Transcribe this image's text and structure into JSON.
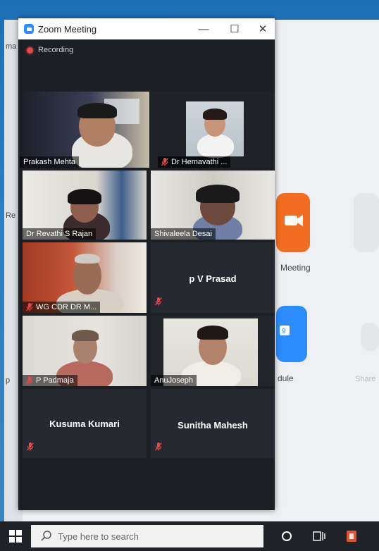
{
  "window": {
    "title": "Zoom Meeting",
    "minimize": "—",
    "maximize": "☐",
    "close": "✕",
    "recording_label": "Recording"
  },
  "participants": [
    {
      "name": "Prakash Mehta",
      "muted": false,
      "video": true,
      "active": true
    },
    {
      "name": "Dr Hemavathi ...",
      "muted": true,
      "video": true,
      "active": false
    },
    {
      "name": "Dr Revathi S Rajan",
      "muted": false,
      "video": true,
      "active": false
    },
    {
      "name": "Shivaleela Desai",
      "muted": false,
      "video": true,
      "active": false
    },
    {
      "name": "WG CDR DR M...",
      "muted": true,
      "video": true,
      "active": false
    },
    {
      "name": "p V Prasad",
      "muted": true,
      "video": false,
      "active": false
    },
    {
      "name": "P Padmaja",
      "muted": true,
      "video": true,
      "active": false
    },
    {
      "name": "AnuJoseph",
      "muted": false,
      "video": true,
      "active": false
    },
    {
      "name": "Kusuma Kumari",
      "muted": true,
      "video": false,
      "active": false
    },
    {
      "name": "Sunitha Mahesh",
      "muted": true,
      "video": false,
      "active": false
    }
  ],
  "background_app": {
    "meeting_label": "Meeting",
    "schedule_label": "dule",
    "share_label": "Share",
    "left_clipped": [
      "ma",
      "Re",
      "p"
    ],
    "brand_colors": {
      "orange": "#f26d21",
      "blue": "#2d8cff"
    }
  },
  "taskbar": {
    "search_placeholder": "Type here to search"
  },
  "colors": {
    "active_speaker": "#b3d63c",
    "mute_red": "#e8484b",
    "zoom_blue": "#2d8cff"
  }
}
